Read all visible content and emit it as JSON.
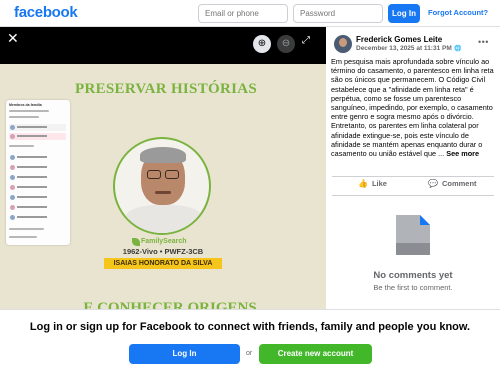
{
  "header": {
    "logo": "facebook",
    "email_placeholder": "Email or phone",
    "password_placeholder": "Password",
    "login_label": "Log In",
    "forgot_label": "Forgot Account?"
  },
  "viewer": {
    "close_icon": "close-icon",
    "zoom_in_icon": "zoom-in-icon",
    "zoom_out_icon": "zoom-out-icon",
    "fullscreen_icon": "fullscreen-icon",
    "photo": {
      "title": "PRESERVAR HISTÓRIAS",
      "bottom_text": "E CONHECER ORIGENS",
      "brand": "FamilySearch",
      "dates": "1962-Vivo • PWFZ-3CB",
      "name": "ISAIAS HONORATO DA SILVA",
      "panel_title": "Membros da família"
    }
  },
  "post": {
    "author": "Frederick Gomes Leite",
    "date": "December 13, 2025 at 11:31 PM",
    "privacy_icon": "globe-icon",
    "text": "Em pesquisa mais aprofundada sobre vínculo ao término do casamento, o parentesco em linha reta são os únicos que permanecem. O Código Civil estabelece que a \"afinidade em linha reta\" é perpétua, como se fosse um parentesco sanguíneo, impedindo, por exemplo, o casamento entre genro e sogra mesmo após o divórcio. Entretanto, os parentes em linha colateral por afinidade extingue-se, pois este vínculo de afinidade se mantém apenas enquanto durar o casamento ou união estável que ...",
    "see_more": "See more",
    "like_label": "Like",
    "comment_label": "Comment",
    "no_comments": "No comments yet",
    "be_first": "Be the first to comment."
  },
  "footer": {
    "cta": "Log in or sign up for Facebook to connect with friends, family and people you know.",
    "login_label": "Log In",
    "or_label": "or",
    "create_label": "Create new account"
  },
  "colors": {
    "brand_blue": "#1877f2",
    "create_green": "#42b72a",
    "photo_green": "#7ab33f",
    "banner_yellow": "#f6c51b"
  }
}
